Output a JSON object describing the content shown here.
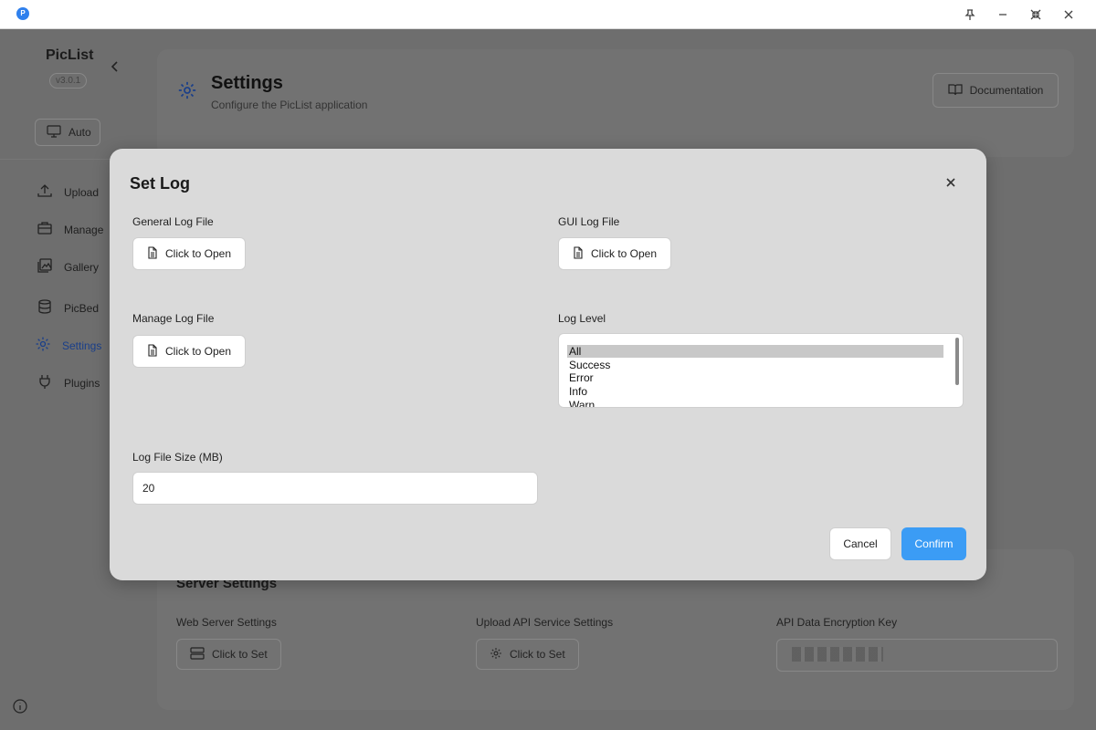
{
  "titlebar": {
    "logo_glyph": "P",
    "icons": [
      "pin-icon",
      "minimize-icon",
      "compress-icon",
      "close-icon"
    ]
  },
  "sidebar": {
    "brand": "PicList",
    "version": "v3.0.1",
    "theme_label": "Auto",
    "items": [
      {
        "label": "Upload",
        "icon": "upload-icon"
      },
      {
        "label": "Manage",
        "icon": "briefcase-icon"
      },
      {
        "label": "Gallery",
        "icon": "gallery-icon"
      },
      {
        "label": "PicBed",
        "icon": "database-icon"
      },
      {
        "label": "Settings",
        "icon": "gear-icon"
      },
      {
        "label": "Plugins",
        "icon": "plug-icon"
      }
    ],
    "active_color": "#1a3f8a"
  },
  "header": {
    "title": "Settings",
    "subtitle": "Configure the PicList application",
    "doc_label": "Documentation"
  },
  "server_settings": {
    "title": "Server Settings",
    "web_label": "Web Server Settings",
    "web_btn": "Click to Set",
    "api_label": "Upload API Service Settings",
    "api_btn": "Click to Set",
    "key_label": "API Data Encryption Key"
  },
  "modal": {
    "title": "Set Log",
    "general_label": "General Log File",
    "general_btn": "Click to Open",
    "gui_label": "GUI Log File",
    "gui_btn": "Click to Open",
    "manage_label": "Manage Log File",
    "manage_btn": "Click to Open",
    "level_label": "Log Level",
    "level_options": [
      "All",
      "Success",
      "Error",
      "Info",
      "Warn"
    ],
    "level_selected": "All",
    "size_label": "Log File Size (MB)",
    "size_value": "20",
    "cancel_label": "Cancel",
    "confirm_label": "Confirm",
    "confirm_color": "#3b9cf5"
  }
}
